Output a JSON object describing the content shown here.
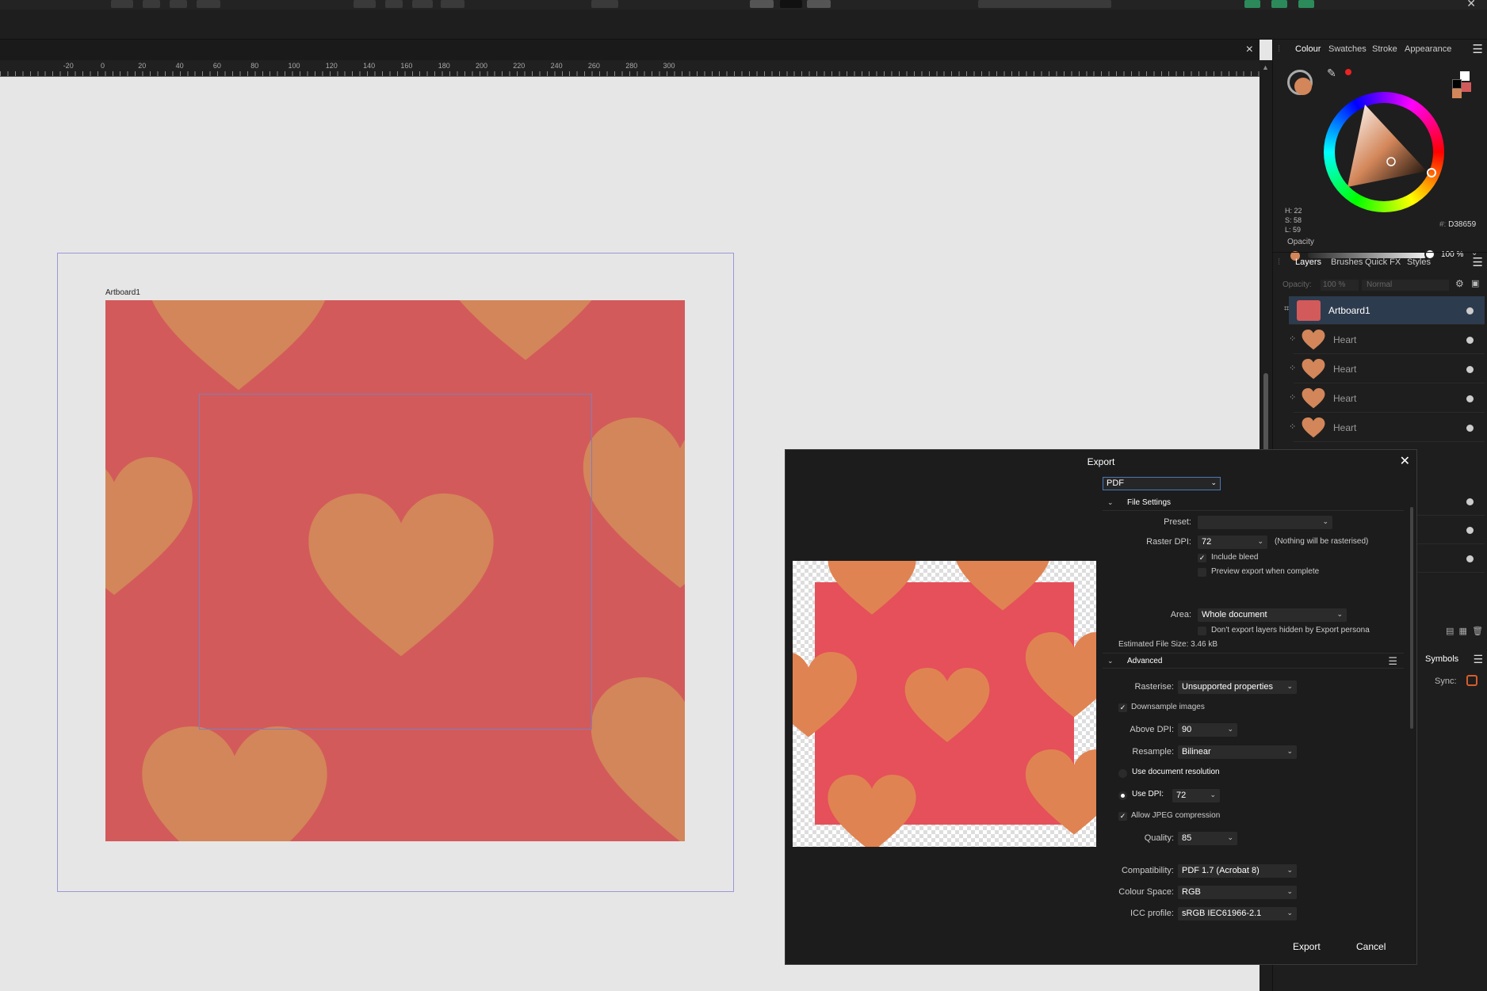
{
  "ruler": {
    "labels": [
      "-20",
      "0",
      "20",
      "40",
      "60",
      "80",
      "100",
      "120",
      "140",
      "160",
      "180",
      "200",
      "220",
      "240",
      "260",
      "280",
      "300"
    ]
  },
  "canvas": {
    "artboard_label": "Artboard1",
    "artboard_color": "#d35a5a",
    "heart_color": "#d38659"
  },
  "colour_panel": {
    "tabs": [
      "Colour",
      "Swatches",
      "Stroke",
      "Appearance"
    ],
    "h": "H: 22",
    "s": "S: 58",
    "l": "L: 59",
    "hex_prefix": "#:",
    "hex": "D38659",
    "opacity_label": "Opacity",
    "opacity_value": "100 %"
  },
  "layers_panel": {
    "tabs": [
      "Layers",
      "Brushes",
      "Quick FX",
      "Styles"
    ],
    "opacity_label": "Opacity:",
    "opacity_value": "100 %",
    "blend_mode": "Normal",
    "layers": [
      {
        "name": "Artboard1",
        "selected": true
      },
      {
        "name": "Heart",
        "selected": false
      },
      {
        "name": "Heart",
        "selected": false
      },
      {
        "name": "Heart",
        "selected": false
      },
      {
        "name": "Heart",
        "selected": false
      }
    ]
  },
  "symbols_panel": {
    "title": "Symbols",
    "sync_label": "Sync:"
  },
  "export_dialog": {
    "title": "Export",
    "format": "PDF",
    "file_settings": {
      "header": "File Settings",
      "preset_label": "Preset:",
      "preset_value": "",
      "raster_dpi_label": "Raster DPI:",
      "raster_dpi_value": "72",
      "raster_note": "(Nothing will be rasterised)",
      "include_bleed": "Include bleed",
      "preview_export": "Preview export when complete",
      "area_label": "Area:",
      "area_value": "Whole document",
      "dont_export_hidden": "Don't export layers hidden by Export persona",
      "estimated_size": "Estimated File Size: 3.46 kB"
    },
    "advanced": {
      "header": "Advanced",
      "rasterise_label": "Rasterise:",
      "rasterise_value": "Unsupported properties",
      "downsample": "Downsample images",
      "above_dpi_label": "Above DPI:",
      "above_dpi_value": "90",
      "resample_label": "Resample:",
      "resample_value": "Bilinear",
      "use_doc_res": "Use document resolution",
      "use_dpi_label": "Use DPI:",
      "use_dpi_value": "72",
      "allow_jpeg": "Allow JPEG compression",
      "quality_label": "Quality:",
      "quality_value": "85",
      "compat_label": "Compatibility:",
      "compat_value": "PDF 1.7 (Acrobat 8)",
      "colour_space_label": "Colour Space:",
      "colour_space_value": "RGB",
      "icc_label": "ICC profile:",
      "icc_value": "sRGB IEC61966-2.1"
    },
    "export_button": "Export",
    "cancel_button": "Cancel"
  }
}
